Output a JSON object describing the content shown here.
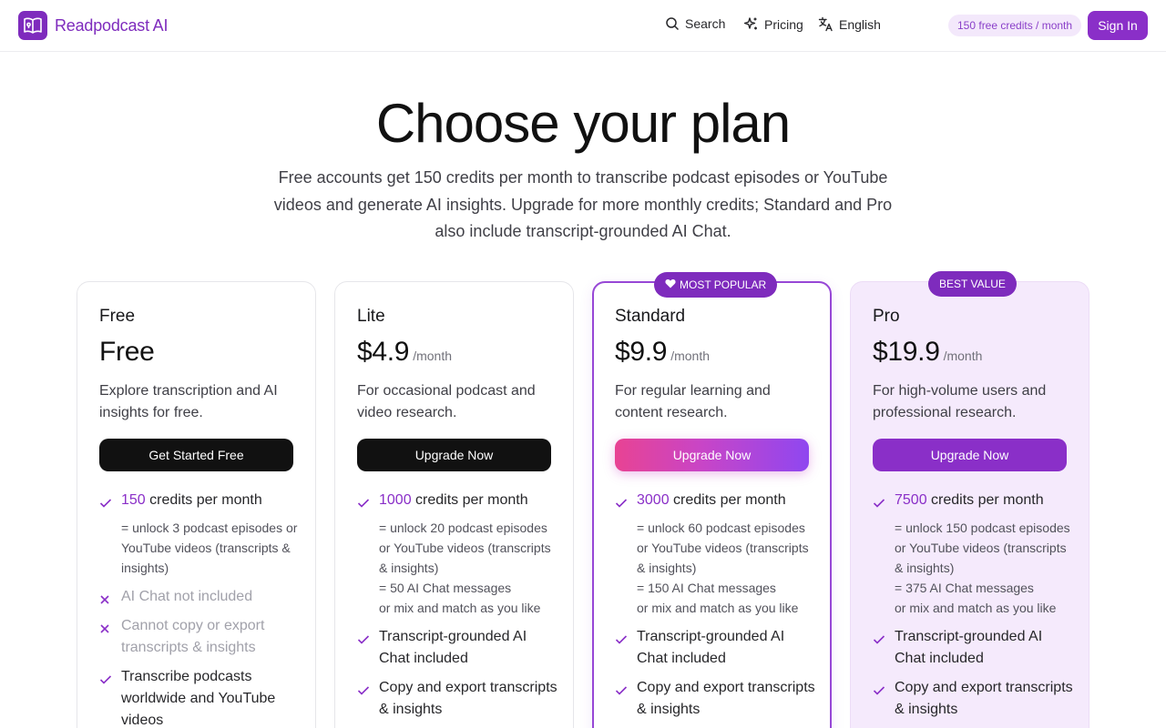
{
  "header": {
    "brand": "Readpodcast AI",
    "nav": {
      "search": "Search",
      "pricing": "Pricing",
      "language": "English"
    },
    "credits_pill": "150 free credits / month",
    "sign_in": "Sign In"
  },
  "hero": {
    "title": "Choose your plan",
    "subtitle": "Free accounts get 150 credits per month to transcribe podcast episodes or YouTube videos and generate AI insights. Upgrade for more monthly credits; Standard and Pro also include transcript-grounded AI Chat."
  },
  "plans": {
    "free": {
      "name": "Free",
      "price": "Free",
      "description": "Explore transcription and AI insights for free.",
      "cta": "Get Started Free",
      "credits_num": "150",
      "credits_text": " credits per month",
      "sub_lines": [
        "= unlock 3 podcast episodes or YouTube videos (transcripts & insights)"
      ],
      "features": [
        {
          "text": "AI Chat not included",
          "included": false
        },
        {
          "text": "Cannot copy or export transcripts & insights",
          "included": false
        },
        {
          "text": "Transcribe podcasts worldwide and YouTube videos",
          "included": true
        }
      ]
    },
    "lite": {
      "name": "Lite",
      "price": "$4.9",
      "period": "/month",
      "description": "For occasional podcast and video research.",
      "cta": "Upgrade Now",
      "credits_num": "1000",
      "credits_text": " credits per month",
      "sub_lines": [
        "= unlock 20 podcast episodes or YouTube videos (transcripts & insights)",
        "= 50 AI Chat messages",
        "or mix and match as you like"
      ],
      "features": [
        {
          "text": "Transcript-grounded AI Chat included",
          "included": true
        },
        {
          "text": "Copy and export transcripts & insights",
          "included": true
        }
      ]
    },
    "standard": {
      "badge": "MOST POPULAR",
      "name": "Standard",
      "price": "$9.9",
      "period": "/month",
      "description": "For regular learning and content research.",
      "cta": "Upgrade Now",
      "credits_num": "3000",
      "credits_text": " credits per month",
      "sub_lines": [
        "= unlock 60 podcast episodes or YouTube videos (transcripts & insights)",
        "= 150 AI Chat messages",
        "or mix and match as you like"
      ],
      "features": [
        {
          "text": "Transcript-grounded AI Chat included",
          "included": true
        },
        {
          "text": "Copy and export transcripts & insights",
          "included": true
        }
      ]
    },
    "pro": {
      "badge": "BEST VALUE",
      "name": "Pro",
      "price": "$19.9",
      "period": "/month",
      "description": "For high-volume users and professional research.",
      "cta": "Upgrade Now",
      "credits_num": "7500",
      "credits_text": " credits per month",
      "sub_lines": [
        "= unlock 150 podcast episodes or YouTube videos (transcripts & insights)",
        "= 375 AI Chat messages",
        "or mix and match as you like"
      ],
      "features": [
        {
          "text": "Transcript-grounded AI Chat included",
          "included": true
        },
        {
          "text": "Copy and export transcripts & insights",
          "included": true
        }
      ]
    }
  },
  "colors": {
    "brand": "#7e2bbd",
    "accent": "#8a2fc8",
    "pill_bg": "#f3e8fb",
    "pro_bg": "#f5eafc"
  },
  "icons": [
    "book-logo-icon",
    "search-icon",
    "sparkle-icon",
    "translate-icon",
    "check-icon",
    "cross-icon",
    "heart-icon"
  ]
}
